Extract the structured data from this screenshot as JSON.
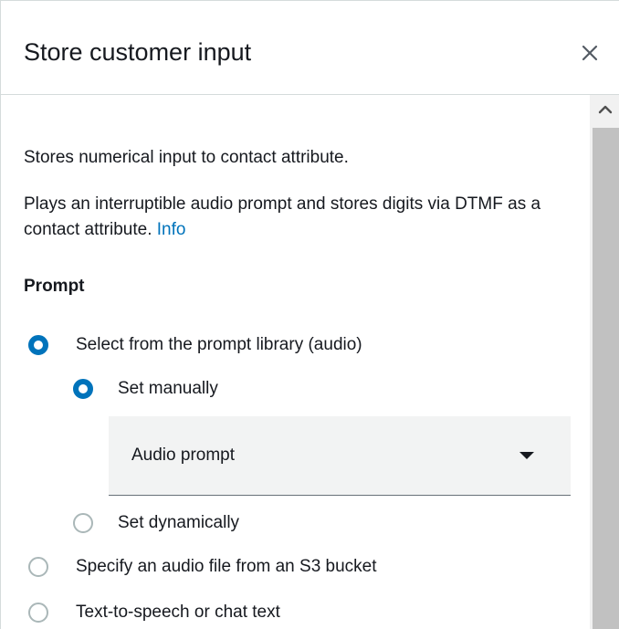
{
  "panel": {
    "title": "Store customer input",
    "close_icon": "close-icon"
  },
  "content": {
    "description": "Stores numerical input to contact attribute.",
    "detail": "Plays an interruptible audio prompt and stores digits via DTMF as a contact attribute.",
    "info_link": "Info"
  },
  "prompt": {
    "section_label": "Prompt",
    "options": [
      {
        "label": "Select from the prompt library (audio)",
        "selected": true
      },
      {
        "label": "Specify an audio file from an S3 bucket",
        "selected": false
      },
      {
        "label": "Text-to-speech or chat text",
        "selected": false
      }
    ],
    "sub_options": [
      {
        "label": "Set manually",
        "selected": true
      },
      {
        "label": "Set dynamically",
        "selected": false
      }
    ],
    "select": {
      "value": "Audio prompt",
      "icon": "caret-down-icon"
    }
  },
  "scrollbar": {
    "up_icon": "chevron-up-icon"
  },
  "colors": {
    "accent": "#0073bb",
    "text": "#16191f",
    "border": "#d5dbdb",
    "select_bg": "#f2f3f3"
  }
}
